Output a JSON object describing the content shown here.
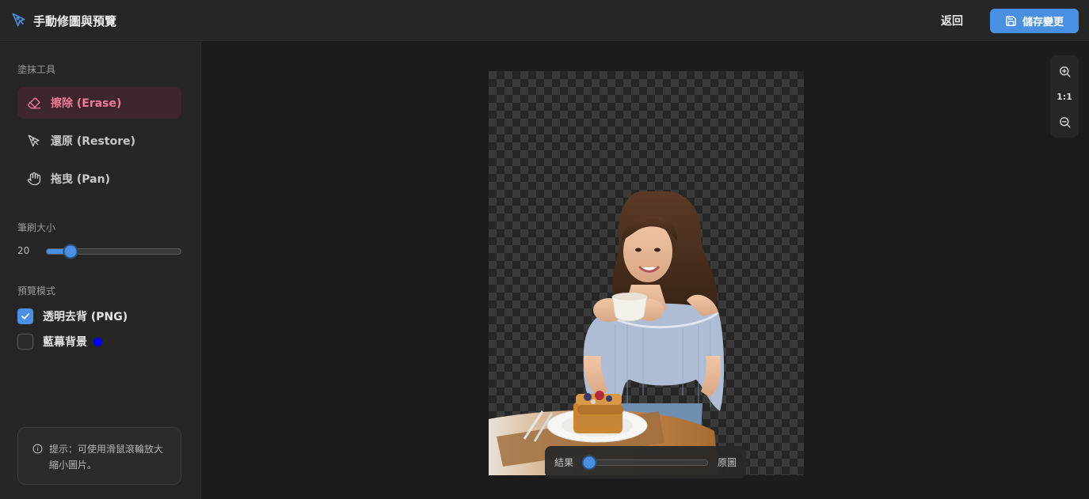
{
  "header": {
    "title": "手動修圖與預覽",
    "back_label": "返回",
    "save_label": "儲存變更",
    "accent": "#4a90e2"
  },
  "sidebar": {
    "tools_title": "塗抹工具",
    "tools": [
      {
        "label": "擦除 (Erase)",
        "icon": "eraser-icon",
        "active": true
      },
      {
        "label": "還原 (Restore)",
        "icon": "pen-restore-icon",
        "active": false
      },
      {
        "label": "拖曳 (Pan)",
        "icon": "hand-icon",
        "active": false
      }
    ],
    "brush_title": "筆刷大小",
    "brush_size": "20",
    "brush_fraction": 0.18,
    "preview_title": "預覽模式",
    "preview_options": [
      {
        "label": "透明去背 (PNG)",
        "checked": true
      },
      {
        "label": "藍幕背景",
        "checked": false,
        "swatch": "#0000ff"
      }
    ],
    "hint": "提示：可使用滑鼠滾輪放大縮小圖片。"
  },
  "zoom": {
    "in_icon": "zoom-in-icon",
    "reset_label": "1:1",
    "out_icon": "zoom-out-icon"
  },
  "compare": {
    "left_label": "結果",
    "right_label": "原圖",
    "fraction": 0.0
  },
  "image": {
    "subject": "woman-with-coffee-and-waffles-cutout"
  }
}
